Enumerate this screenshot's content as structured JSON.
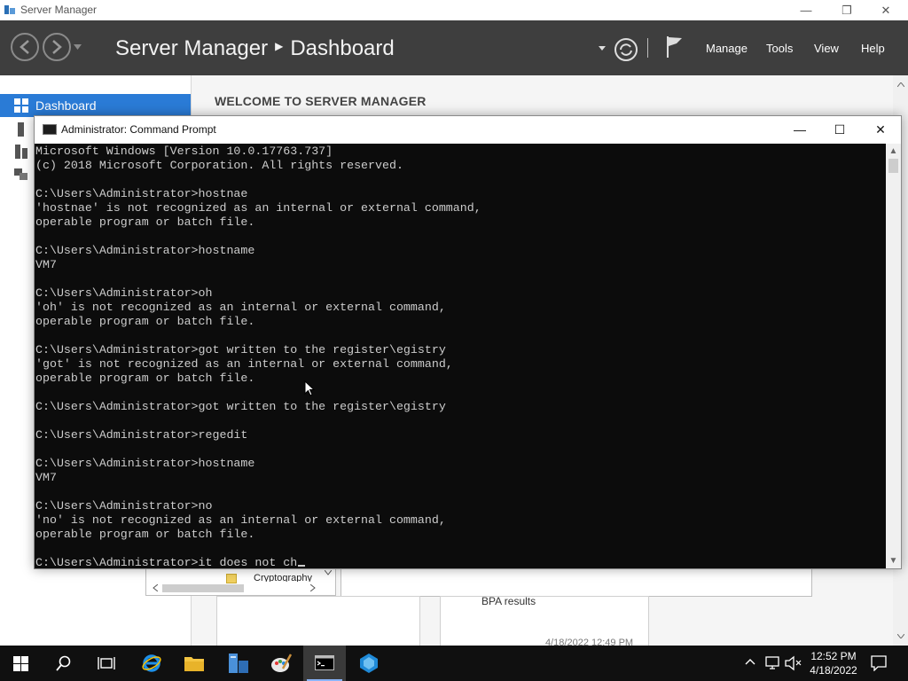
{
  "server_manager": {
    "window_title": "Server Manager",
    "breadcrumb": {
      "app": "Server Manager",
      "page": "Dashboard"
    },
    "menu": [
      "Manage",
      "Tools",
      "View",
      "Help"
    ],
    "sidebar": {
      "active_item": "Dashboard"
    },
    "welcome_title": "WELCOME TO SERVER MANAGER",
    "tree_fragment_text": "Cryptography",
    "bpa_label": "BPA results",
    "tile_timestamp": "4/18/2022 12:49 PM"
  },
  "command_prompt": {
    "title": "Administrator: Command Prompt",
    "lines": [
      "Microsoft Windows [Version 10.0.17763.737]",
      "(c) 2018 Microsoft Corporation. All rights reserved.",
      "",
      "C:\\Users\\Administrator>hostnae",
      "'hostnae' is not recognized as an internal or external command,",
      "operable program or batch file.",
      "",
      "C:\\Users\\Administrator>hostname",
      "VM7",
      "",
      "C:\\Users\\Administrator>oh",
      "'oh' is not recognized as an internal or external command,",
      "operable program or batch file.",
      "",
      "C:\\Users\\Administrator>got written to the register\\egistry",
      "'got' is not recognized as an internal or external command,",
      "operable program or batch file.",
      "",
      "C:\\Users\\Administrator>got written to the register\\egistry",
      "",
      "C:\\Users\\Administrator>regedit",
      "",
      "C:\\Users\\Administrator>hostname",
      "VM7",
      "",
      "C:\\Users\\Administrator>no",
      "'no' is not recognized as an internal or external command,",
      "operable program or batch file.",
      "",
      "C:\\Users\\Administrator>it does not ch"
    ]
  },
  "taskbar": {
    "clock_time": "12:52 PM",
    "clock_date": "4/18/2022",
    "items": [
      "start",
      "search",
      "task-view",
      "internet-explorer",
      "file-explorer",
      "server-manager",
      "paint",
      "command-prompt",
      "hyper-v"
    ]
  },
  "colors": {
    "accent": "#2a7bd6",
    "header_bg": "#3e3e3e",
    "console_bg": "#0c0c0c",
    "console_fg": "#cccccc",
    "taskbar_bg": "#101010"
  }
}
